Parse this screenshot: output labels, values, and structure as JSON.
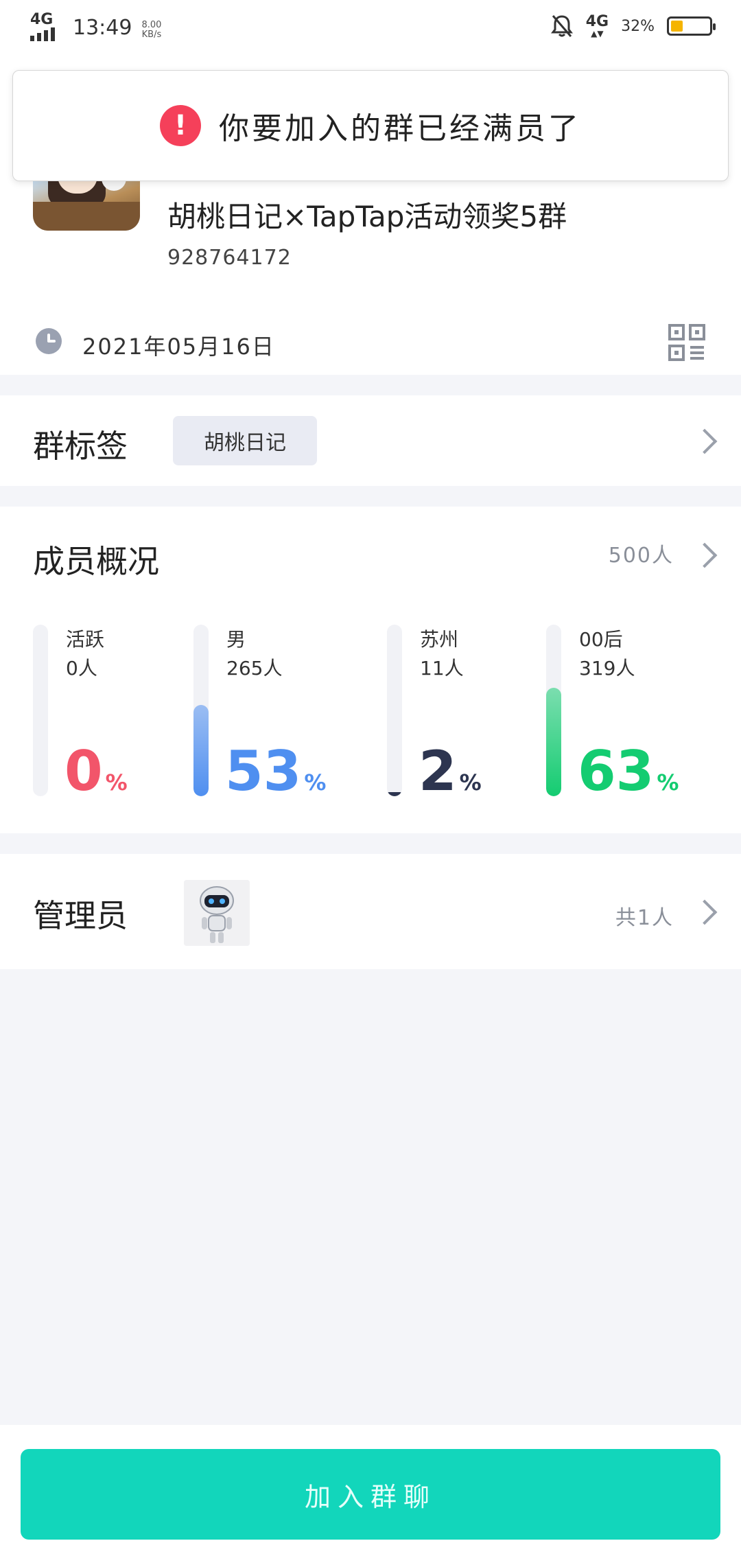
{
  "status_bar": {
    "network": "4G",
    "time": "13:49",
    "speed_value": "8.00",
    "speed_unit": "KB/s",
    "network_right": "4G",
    "battery_percent": "32%",
    "battery_level": 0.32
  },
  "toast": {
    "message": "你要加入的群已经满员了"
  },
  "group": {
    "name": "胡桃日记×TapTap活动领奖5群",
    "id": "928764172",
    "created_date": "2021年05月16日"
  },
  "tags": {
    "title": "群标签",
    "items": [
      "胡桃日记"
    ]
  },
  "members": {
    "title": "成员概况",
    "count": "500人",
    "stats": [
      {
        "label": "活跃",
        "sub": "0人",
        "percent": "0",
        "pct_symbol": "%",
        "value": 0,
        "color": "#f2556a"
      },
      {
        "label": "男",
        "sub": "265人",
        "percent": "53",
        "pct_symbol": "%",
        "value": 53,
        "color": "#4f8ff0"
      },
      {
        "label": "苏州",
        "sub": "11人",
        "percent": "2",
        "pct_symbol": "%",
        "value": 2,
        "color": "#2d3550"
      },
      {
        "label": "00后",
        "sub": "319人",
        "percent": "63",
        "pct_symbol": "%",
        "value": 63,
        "color": "#14cc71"
      }
    ]
  },
  "admins": {
    "title": "管理员",
    "count": "共1人"
  },
  "join_button": {
    "label": "加入群聊"
  },
  "colors": {
    "accent": "#12d6bb",
    "alert": "#f5405a"
  }
}
